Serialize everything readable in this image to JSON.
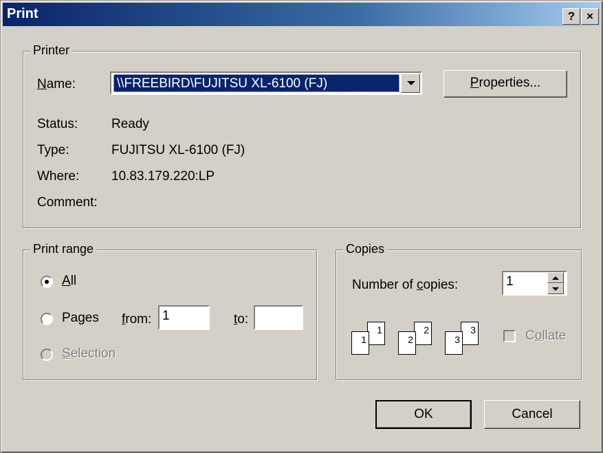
{
  "window": {
    "title": "Print",
    "help_label": "?",
    "close_label": "×"
  },
  "printer": {
    "group_label": "Printer",
    "name_label": "Name:",
    "name_value": "\\\\FREEBIRD\\FUJITSU XL-6100 (FJ)",
    "properties_label": "Properties...",
    "status_label": "Status:",
    "status_value": "Ready",
    "type_label": "Type:",
    "type_value": "FUJITSU XL-6100 (FJ)",
    "where_label": "Where:",
    "where_value": "10.83.179.220:LP",
    "comment_label": "Comment:"
  },
  "range": {
    "group_label": "Print range",
    "all_label": "All",
    "pages_label": "Pages",
    "from_label": "from:",
    "from_value": "1",
    "to_label": "to:",
    "to_value": "",
    "selection_label": "Selection",
    "selected": "all"
  },
  "copies": {
    "group_label": "Copies",
    "number_label": "Number of copies:",
    "number_value": "1",
    "collate_label": "Collate",
    "collate_checked": false,
    "collate_enabled": false,
    "pages": [
      "1",
      "1",
      "2",
      "2",
      "3",
      "3"
    ]
  },
  "buttons": {
    "ok": "OK",
    "cancel": "Cancel"
  }
}
